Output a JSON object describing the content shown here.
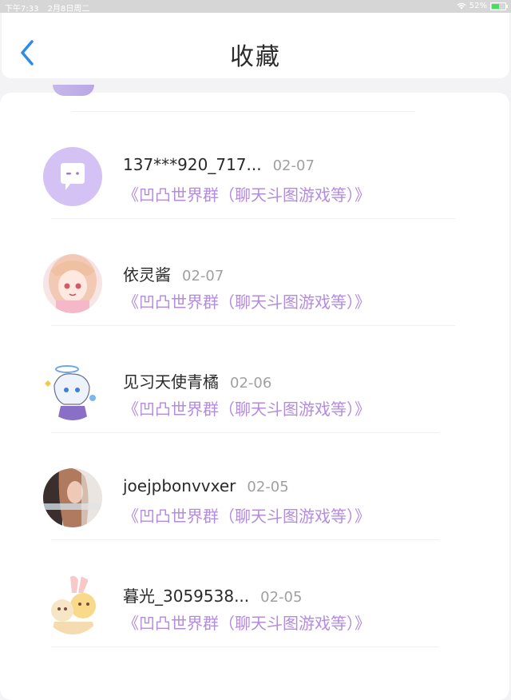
{
  "status_bar": {
    "time": "下午7:33",
    "date": "2月8日周二",
    "battery": "52%"
  },
  "header": {
    "title": "收藏"
  },
  "items": [
    {
      "name": "137***920_717...",
      "date": "02-07",
      "group": "《凹凸世界群（聊天斗图游戏等）》",
      "avatar": "chat-bubble-avatar"
    },
    {
      "name": "依灵酱",
      "date": "02-07",
      "group": "《凹凸世界群（聊天斗图游戏等）》",
      "avatar": "anime-girl-avatar"
    },
    {
      "name": "见习天使青橘",
      "date": "02-06",
      "group": "《凹凸世界群（聊天斗图游戏等）》",
      "avatar": "angel-avatar"
    },
    {
      "name": "joejpbonvvxer",
      "date": "02-05",
      "group": "《凹凸世界群（聊天斗图游戏等）》",
      "avatar": "photo-avatar"
    },
    {
      "name": "暮光_3059538...",
      "date": "02-05",
      "group": "《凹凸世界群（聊天斗图游戏等）》",
      "avatar": "bunny-avatar"
    }
  ],
  "colors": {
    "accent": "#b38ce0",
    "back_icon": "#2e8be8",
    "status_bar": "#d6d6d6"
  }
}
